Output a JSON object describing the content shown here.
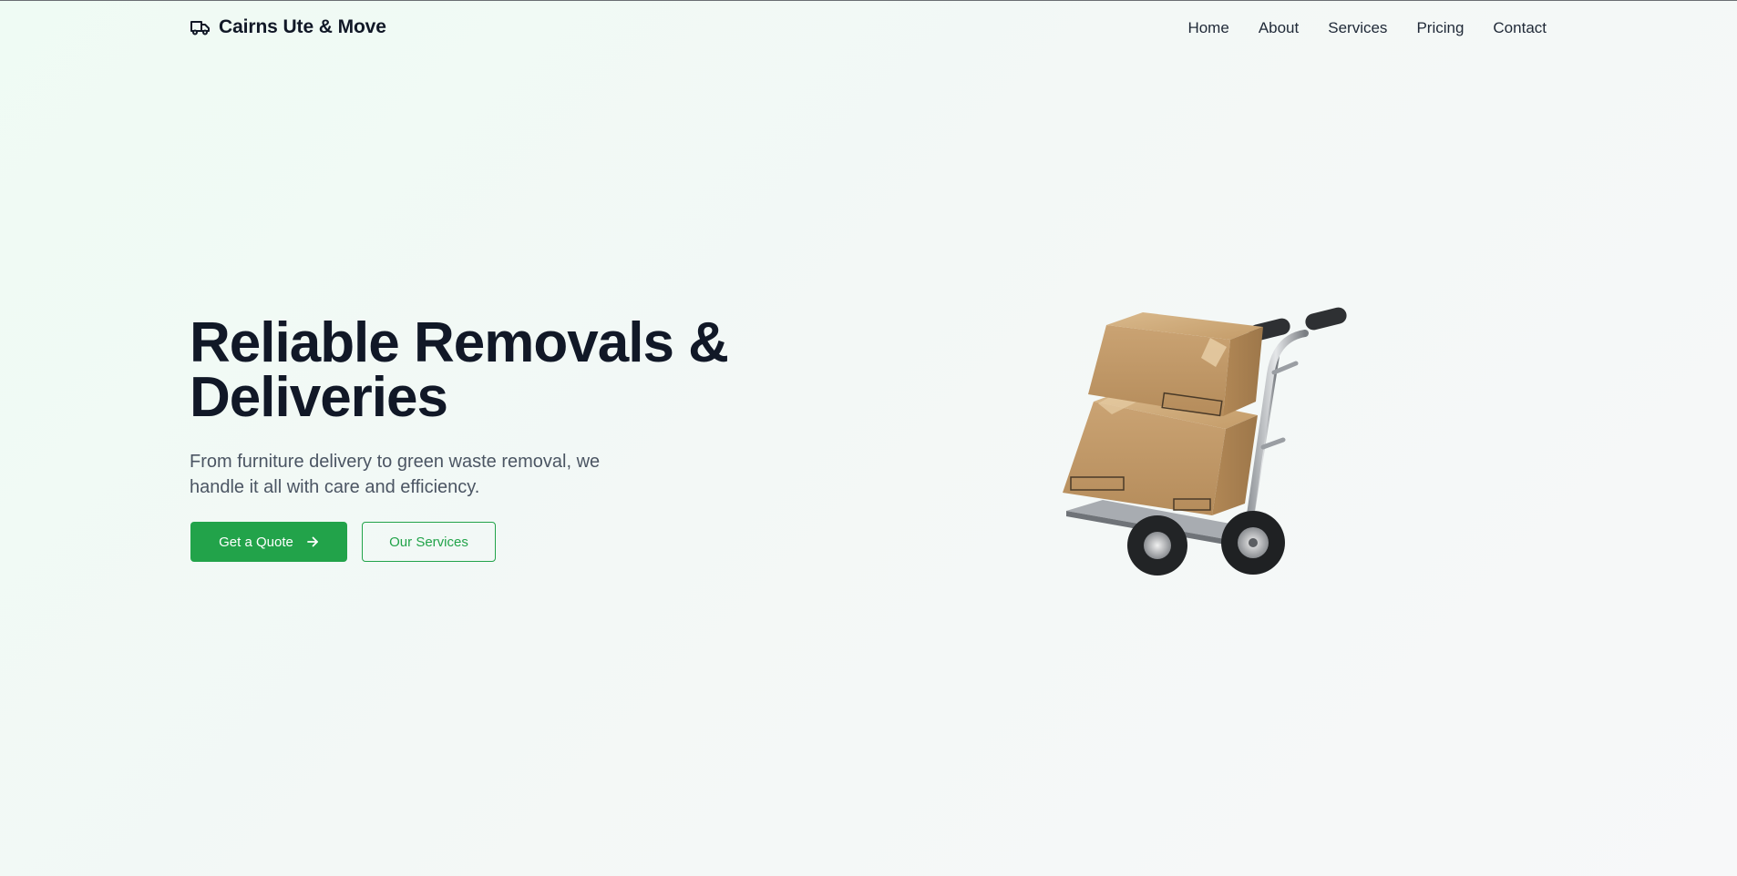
{
  "nav": {
    "brand_icon": "truck-icon",
    "brand": "Cairns Ute & Move",
    "links": [
      "Home",
      "About",
      "Services",
      "Pricing",
      "Contact"
    ]
  },
  "hero": {
    "title": "Reliable Removals & Deliveries",
    "subtitle": "From furniture delivery to green waste removal, we handle it all with care and efficiency.",
    "primary_button": "Get a Quote",
    "primary_button_icon": "arrow-right-icon",
    "secondary_button": "Our Services",
    "image": "hand-truck-with-boxes"
  },
  "colors": {
    "accent": "#22a34a",
    "heading": "#111827",
    "body_text": "#4b5563"
  }
}
